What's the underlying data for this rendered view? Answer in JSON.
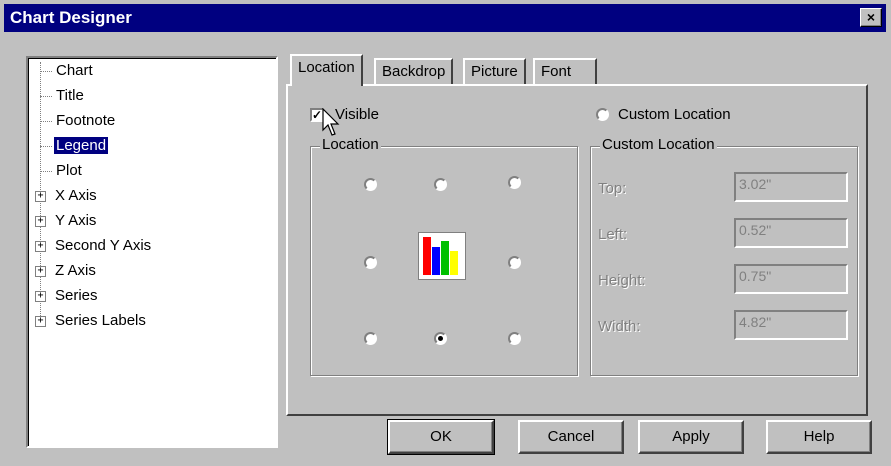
{
  "window": {
    "title": "Chart Designer",
    "close_label": "×"
  },
  "tree": {
    "items": [
      {
        "label": "Chart",
        "expandable": false,
        "selected": false
      },
      {
        "label": "Title",
        "expandable": false,
        "selected": false
      },
      {
        "label": "Footnote",
        "expandable": false,
        "selected": false
      },
      {
        "label": "Legend",
        "expandable": false,
        "selected": true
      },
      {
        "label": "Plot",
        "expandable": false,
        "selected": false
      },
      {
        "label": "X Axis",
        "expandable": true,
        "selected": false
      },
      {
        "label": "Y Axis",
        "expandable": true,
        "selected": false
      },
      {
        "label": "Second Y Axis",
        "expandable": true,
        "selected": false
      },
      {
        "label": "Z Axis",
        "expandable": true,
        "selected": false
      },
      {
        "label": "Series",
        "expandable": true,
        "selected": false
      },
      {
        "label": "Series Labels",
        "expandable": true,
        "selected": false
      }
    ],
    "expand_symbol": "+"
  },
  "tabs": [
    {
      "label": "Location",
      "active": true
    },
    {
      "label": "Backdrop",
      "active": false
    },
    {
      "label": "Picture",
      "active": false
    },
    {
      "label": "Font",
      "active": false
    }
  ],
  "location_tab": {
    "visible_label": "Visible",
    "visible_checked": true,
    "check_mark": "✓",
    "custom_location_label": "Custom Location",
    "custom_location_selected": false,
    "location_group_label": "Location",
    "location_selected": "bottom-center",
    "custom_group_label": "Custom Location",
    "fields": [
      {
        "label": "Top:",
        "value": "3.02\""
      },
      {
        "label": "Left:",
        "value": "0.52\""
      },
      {
        "label": "Height:",
        "value": "0.75\""
      },
      {
        "label": "Width:",
        "value": "4.82\""
      }
    ]
  },
  "buttons": {
    "ok": "OK",
    "cancel": "Cancel",
    "apply": "Apply",
    "help": "Help"
  },
  "colors": {
    "title_bar": "#000080",
    "selection": "#000080",
    "preview_bars": [
      "#ff0000",
      "#0000ff",
      "#00c000",
      "#ffff00"
    ]
  }
}
